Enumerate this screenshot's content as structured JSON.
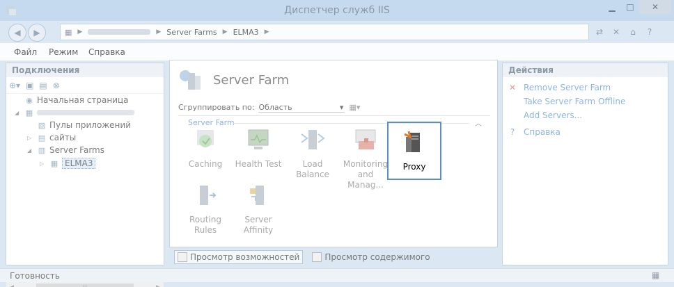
{
  "window": {
    "title": "Диспетчер служб IIS"
  },
  "address": {
    "crumbs": [
      "Server Farms",
      "ELMA3"
    ]
  },
  "menu": {
    "items": [
      "Файл",
      "Режим",
      "Справка"
    ]
  },
  "connections": {
    "header": "Подключения",
    "tree": {
      "start_page": "Начальная страница",
      "app_pools": "Пулы приложений",
      "sites": "сайты",
      "server_farms": "Server Farms",
      "elma3": "ELMA3"
    }
  },
  "feature_view": {
    "title": "Server Farm",
    "group_by_label": "Сгруппировать по:",
    "group_by_value": "Область",
    "section": "Server Farm",
    "features": [
      {
        "label": "Caching",
        "icon": "caching-icon"
      },
      {
        "label": "Health Test",
        "icon": "health-test-icon"
      },
      {
        "label": "Load Balance",
        "icon": "load-balance-icon"
      },
      {
        "label": "Monitoring and Manag...",
        "icon": "monitoring-icon"
      },
      {
        "label": "Proxy",
        "icon": "proxy-icon"
      },
      {
        "label": "Routing Rules",
        "icon": "routing-rules-icon"
      },
      {
        "label": "Server Affinity",
        "icon": "server-affinity-icon"
      }
    ],
    "view_tabs": [
      "Просмотр возможностей",
      "Просмотр содержимого"
    ]
  },
  "actions": {
    "header": "Действия",
    "items": [
      "Remove Server Farm",
      "Take Server Farm Offline",
      "Add Servers...",
      "Справка"
    ]
  },
  "status": {
    "text": "Готовность"
  },
  "colors": {
    "accent": "#5a8fc2",
    "link": "#8db6df",
    "titlebar": "#c5daee"
  }
}
